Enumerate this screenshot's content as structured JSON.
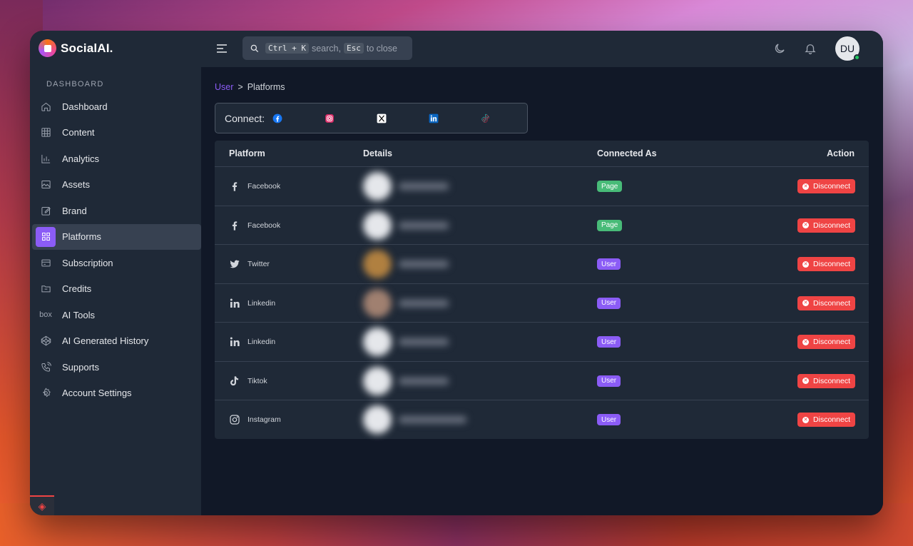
{
  "app": {
    "name": "SocialAI."
  },
  "sidebar": {
    "section_label": "DASHBOARD",
    "items": [
      {
        "label": "Dashboard",
        "icon": "home-icon"
      },
      {
        "label": "Content",
        "icon": "grid-icon"
      },
      {
        "label": "Analytics",
        "icon": "bar-chart-icon"
      },
      {
        "label": "Assets",
        "icon": "image-icon"
      },
      {
        "label": "Brand",
        "icon": "edit-icon"
      },
      {
        "label": "Platforms",
        "icon": "apps-icon",
        "active": true
      },
      {
        "label": "Subscription",
        "icon": "card-icon"
      },
      {
        "label": "Credits",
        "icon": "folder-icon"
      },
      {
        "label": "AI Tools",
        "icon": "box-icon"
      },
      {
        "label": "AI Generated History",
        "icon": "codepen-icon"
      },
      {
        "label": "Supports",
        "icon": "phone-icon"
      },
      {
        "label": "Account Settings",
        "icon": "gear-icon"
      }
    ]
  },
  "topbar": {
    "search": {
      "kbd1": "Ctrl + K",
      "text1": "search,",
      "kbd2": "Esc",
      "text2": "to close"
    },
    "avatar_initials": "DU"
  },
  "breadcrumb": {
    "parent": "User",
    "separator": ">",
    "current": "Platforms"
  },
  "connect": {
    "label": "Connect:",
    "platforms": [
      "facebook-icon",
      "instagram-icon",
      "x-icon",
      "linkedin-icon",
      "tiktok-icon"
    ]
  },
  "table": {
    "headers": {
      "platform": "Platform",
      "details": "Details",
      "connected_as": "Connected As",
      "action": "Action"
    },
    "rows": [
      {
        "platform": "Facebook",
        "connected_as": "Page",
        "action": "Disconnect"
      },
      {
        "platform": "Facebook",
        "connected_as": "Page",
        "action": "Disconnect"
      },
      {
        "platform": "Twitter",
        "connected_as": "User",
        "action": "Disconnect"
      },
      {
        "platform": "Linkedin",
        "connected_as": "User",
        "action": "Disconnect"
      },
      {
        "platform": "Linkedin",
        "connected_as": "User",
        "action": "Disconnect"
      },
      {
        "platform": "Tiktok",
        "connected_as": "User",
        "action": "Disconnect"
      },
      {
        "platform": "Instagram",
        "connected_as": "User",
        "action": "Disconnect"
      }
    ]
  },
  "colors": {
    "accent": "#8b5cf6",
    "page_badge": "#48bb78",
    "user_badge": "#8b5cf6",
    "danger": "#ef4444"
  }
}
